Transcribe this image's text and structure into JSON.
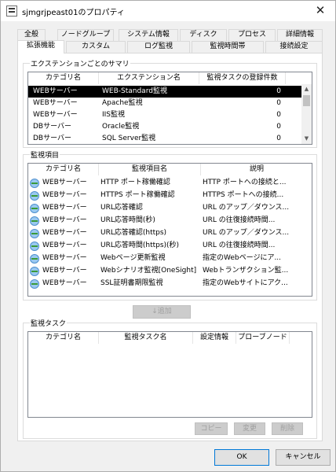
{
  "window": {
    "title": "sjmgrjpeast01のプロパティ",
    "close_label": "✕"
  },
  "tabs_row1": [
    "全般",
    "ノードグループ",
    "システム情報",
    "ディスク",
    "プロセス",
    "詳細情報"
  ],
  "tabs_row2": [
    "拡張機能",
    "カスタム",
    "ログ監視",
    "監視時間帯",
    "接続設定"
  ],
  "active_tab": "拡張機能",
  "summary": {
    "title": "エクステンションごとのサマリ",
    "columns": [
      "カテゴリ名",
      "エクステンション名",
      "監視タスクの登録件数"
    ],
    "rows": [
      {
        "category": "WEBサーバー",
        "extension": "WEB-Standard監視",
        "count": "0",
        "selected": true
      },
      {
        "category": "WEBサーバー",
        "extension": "Apache監視",
        "count": "0"
      },
      {
        "category": "WEBサーバー",
        "extension": "IIS監視",
        "count": "0"
      },
      {
        "category": "DBサーバー",
        "extension": "Oracle監視",
        "count": "0"
      },
      {
        "category": "DBサーバー",
        "extension": "SQL Server監視",
        "count": "0"
      }
    ]
  },
  "items": {
    "title": "監視項目",
    "columns": [
      "カテゴリ名",
      "監視項目名",
      "説明"
    ],
    "rows": [
      {
        "category": "WEBサーバー",
        "name": "HTTP ポート稼働確認",
        "desc": "HTTP ポートへの接続と..."
      },
      {
        "category": "WEBサーバー",
        "name": "HTTPS ポート稼働確認",
        "desc": "HTTPS ポートへの接続..."
      },
      {
        "category": "WEBサーバー",
        "name": "URL応答確認",
        "desc": "URL のアップ／ダウンス..."
      },
      {
        "category": "WEBサーバー",
        "name": "URL応答時間(秒)",
        "desc": "URL の往復接続時間..."
      },
      {
        "category": "WEBサーバー",
        "name": "URL応答確認(https)",
        "desc": "URL のアップ／ダウンス..."
      },
      {
        "category": "WEBサーバー",
        "name": "URL応答時間(https)(秒)",
        "desc": "URL の往復接続時間..."
      },
      {
        "category": "WEBサーバー",
        "name": "Webページ更新監視",
        "desc": "指定のWebページにア..."
      },
      {
        "category": "WEBサーバー",
        "name": "Webシナリオ監視[OneSight]",
        "desc": "Webトランザクション監..."
      },
      {
        "category": "WEBサーバー",
        "name": "SSL証明書期限監視",
        "desc": "指定のWebサイトにアク..."
      }
    ]
  },
  "add_button": "↓追加",
  "tasks": {
    "title": "監視タスク",
    "columns": [
      "カテゴリ名",
      "監視タスク名",
      "設定情報",
      "プローブノード"
    ],
    "rows": []
  },
  "task_buttons": {
    "copy": "コピー",
    "edit": "変更",
    "delete": "削除"
  },
  "footer": {
    "ok": "OK",
    "cancel": "キャンセル"
  }
}
